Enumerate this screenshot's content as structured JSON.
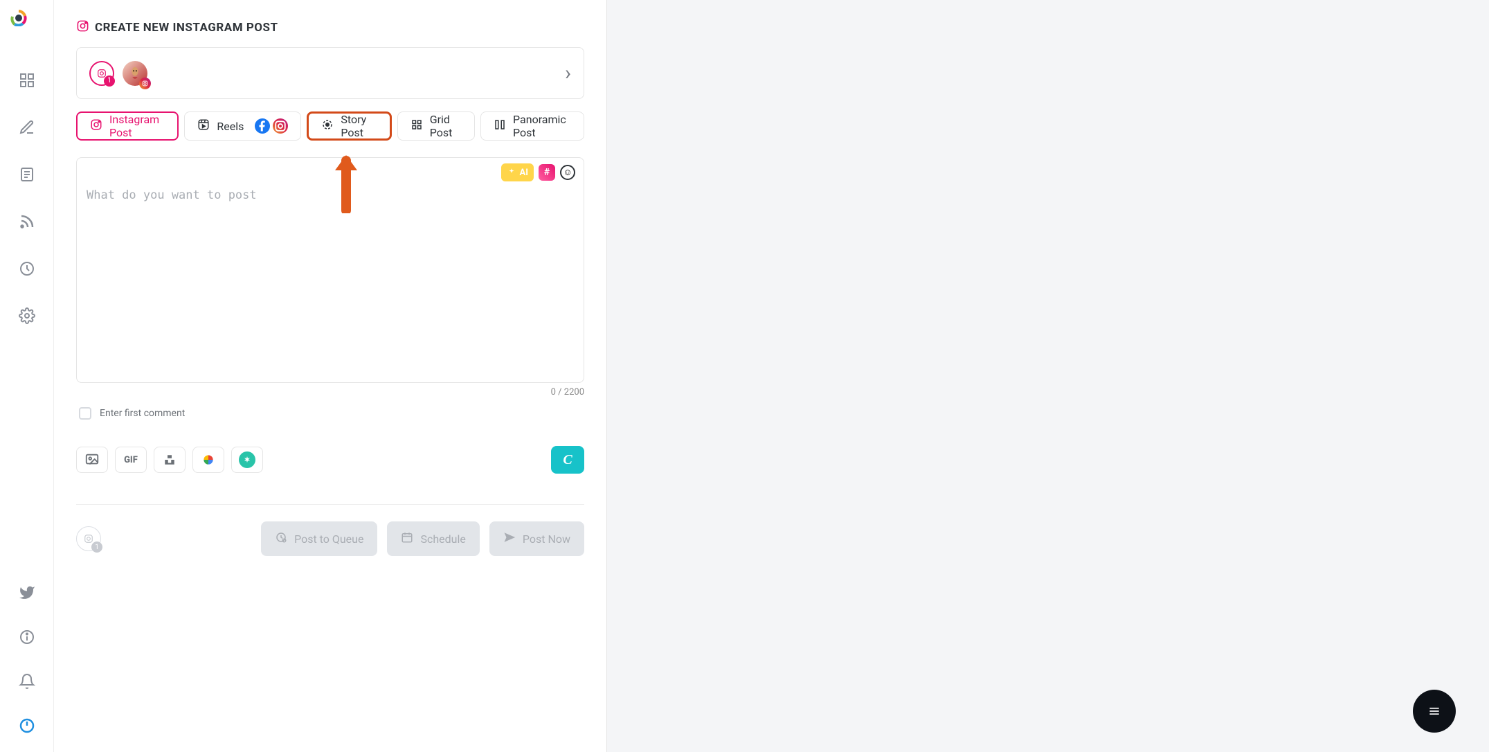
{
  "colors": {
    "accent": "#e7136f",
    "muted": "#a9adb3",
    "border": "#e5e5e5",
    "highlight": "#d34a19"
  },
  "sidebar": {
    "top_items": [
      "dashboard",
      "compose",
      "library",
      "rss",
      "analytics",
      "settings"
    ],
    "bottom_items": [
      "twitter",
      "info",
      "notifications",
      "power"
    ]
  },
  "page": {
    "title": "CREATE NEW INSTAGRAM POST",
    "title_icon": "instagram-icon"
  },
  "accounts": {
    "first_badge": "1",
    "second_avatar": "peanut-character",
    "expand_icon": "chevron-right"
  },
  "tabs": [
    {
      "id": "instagram-post",
      "label": "Instagram Post",
      "icon": "instagram-icon",
      "active": true
    },
    {
      "id": "reels",
      "label": "Reels",
      "icon": "clapperboard-icon",
      "networks": [
        "facebook",
        "instagram"
      ]
    },
    {
      "id": "story-post",
      "label": "Story Post",
      "icon": "story-circle-icon",
      "highlighted": true
    },
    {
      "id": "grid-post",
      "label": "Grid Post",
      "icon": "grid-icon"
    },
    {
      "id": "panoramic-post",
      "label": "Panoramic Post",
      "icon": "panorama-columns-icon"
    }
  ],
  "compose": {
    "placeholder": "What do you want to post",
    "value": "",
    "char_count": "0",
    "char_limit": "2200",
    "counter_text": "0 / 2200",
    "ai_label": "AI"
  },
  "first_comment": {
    "label": "Enter first comment",
    "checked": false
  },
  "media_buttons": [
    "image",
    "gif",
    "unsplash",
    "google-photos",
    "giphy"
  ],
  "canva_label": "C",
  "footer": {
    "queue_badge": "1",
    "buttons": [
      {
        "id": "post-to-queue",
        "label": "Post to Queue",
        "icon": "clock-queue-icon"
      },
      {
        "id": "schedule",
        "label": "Schedule",
        "icon": "calendar-icon"
      },
      {
        "id": "post-now",
        "label": "Post Now",
        "icon": "paper-plane-icon"
      }
    ]
  },
  "fab_icon": "menu-icon"
}
